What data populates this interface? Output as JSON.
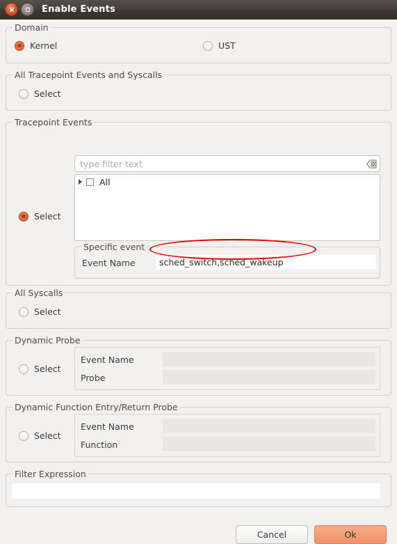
{
  "window": {
    "title": "Enable Events",
    "close_icon": "close-icon",
    "maximize_icon": "maximize-icon"
  },
  "domain": {
    "legend": "Domain",
    "options": [
      {
        "label": "Kernel",
        "selected": true
      },
      {
        "label": "UST",
        "selected": false
      }
    ]
  },
  "all_tracepoints": {
    "legend": "All Tracepoint Events and Syscalls",
    "select_label": "Select",
    "selected": false
  },
  "tracepoint_events": {
    "legend": "Tracepoint Events",
    "select_label": "Select",
    "selected": true,
    "filter": {
      "placeholder": "type filter text",
      "value": "",
      "clear_icon": "clear-filter-icon"
    },
    "tree": {
      "expand_icon": "expand-triangle-icon",
      "items": [
        {
          "label": "All",
          "checked": false
        }
      ]
    },
    "specific_event": {
      "legend": "Specific event",
      "field_label": "Event Name",
      "field_value": "sched_switch,sched_wakeup"
    }
  },
  "all_syscalls": {
    "legend": "All Syscalls",
    "select_label": "Select",
    "selected": false
  },
  "dynamic_probe": {
    "legend": "Dynamic Probe",
    "select_label": "Select",
    "selected": false,
    "fields": [
      {
        "label": "Event Name",
        "value": ""
      },
      {
        "label": "Probe",
        "value": ""
      }
    ]
  },
  "dynamic_function_probe": {
    "legend": "Dynamic Function Entry/Return Probe",
    "select_label": "Select",
    "selected": false,
    "fields": [
      {
        "label": "Event Name",
        "value": ""
      },
      {
        "label": "Function",
        "value": ""
      }
    ]
  },
  "filter_expression": {
    "legend": "Filter Expression",
    "value": ""
  },
  "buttons": {
    "cancel": "Cancel",
    "ok": "Ok"
  },
  "annotation": {
    "shape": "red-ellipse",
    "color": "#e60000",
    "target": "sched_switch,sched_wakeup"
  },
  "colors": {
    "accent": "#e2703d",
    "ok_button": "#f4a07a",
    "titlebar": "#3c3933",
    "background": "#f2f1f0"
  }
}
